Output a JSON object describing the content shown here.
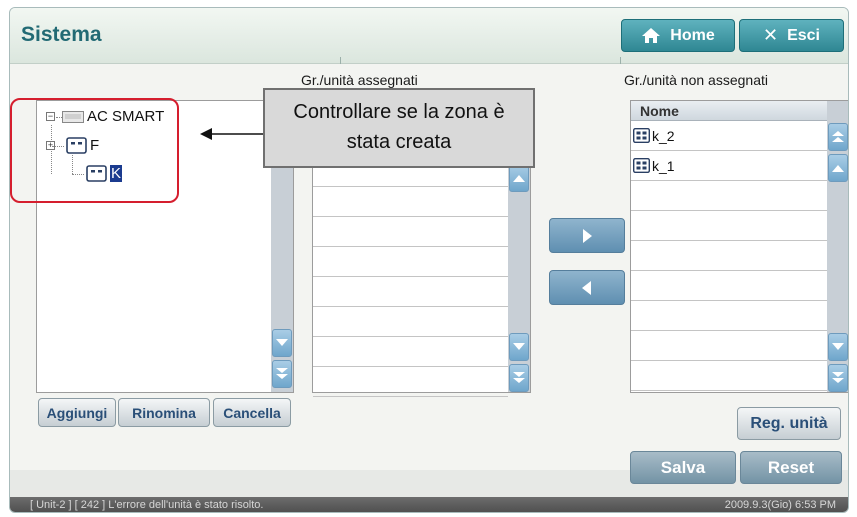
{
  "header": {
    "title": "Sistema",
    "home_label": "Home",
    "exit_label": "Esci"
  },
  "tree_panel": {
    "root_label": "AC SMART",
    "nodes": [
      {
        "label": "F"
      },
      {
        "label": "K"
      }
    ],
    "buttons": {
      "add": "Aggiungi",
      "rename": "Rinomina",
      "delete": "Cancella"
    }
  },
  "assigned_panel": {
    "label": "Gr./unità assegnati"
  },
  "unassigned_panel": {
    "label": "Gr./unità non assegnati",
    "column_header": "Nome",
    "items": [
      {
        "label": "k_2"
      },
      {
        "label": "k_1"
      }
    ],
    "register_button": "Reg. unità"
  },
  "callout": {
    "line1": "Controllare se la zona è",
    "line2": "stata creata"
  },
  "actions": {
    "save": "Salva",
    "reset": "Reset"
  },
  "status_bar": {
    "message": "[ Unit-2 ] [ 242 ] L'errore dell'unità è stato risolto.",
    "datetime": "2009.9.3(Gio)  6:53 PM"
  },
  "colors": {
    "title": "#226a74",
    "header_button": "#2f8793",
    "highlight": "#d51e2e",
    "selection": "#1b3b8f"
  }
}
